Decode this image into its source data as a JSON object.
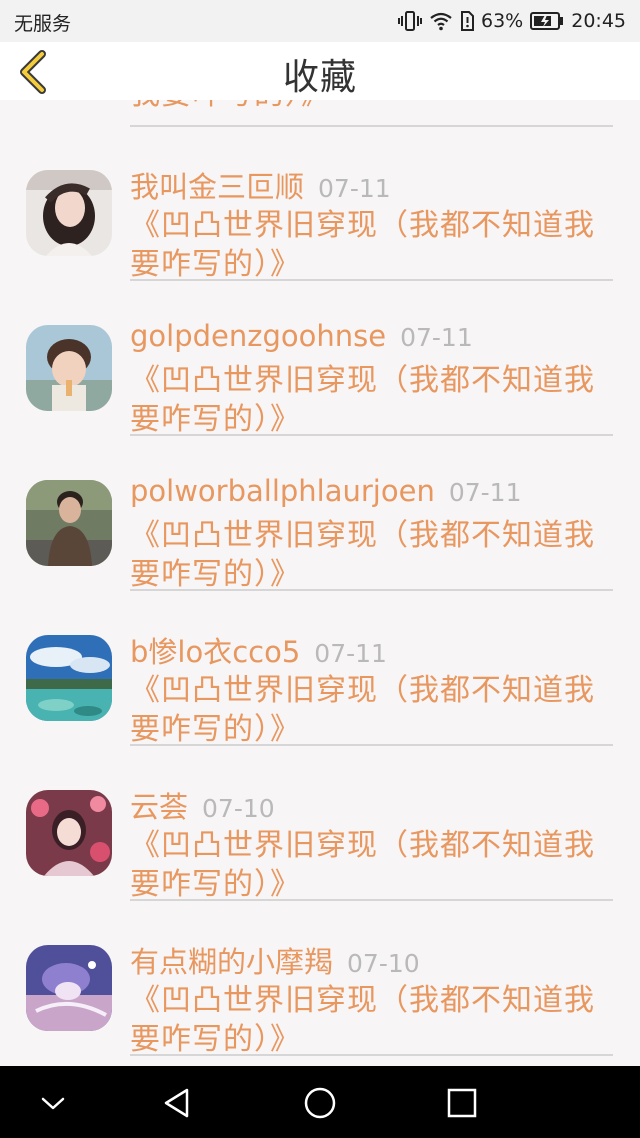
{
  "status_bar": {
    "carrier": "无服务",
    "battery_percent": "63%",
    "time": "20:45"
  },
  "header": {
    "title": "收藏",
    "back_icon": "chevron-left-icon",
    "accent": "#e8975f"
  },
  "partial_item": {
    "content": "我要咋写的）》"
  },
  "items": [
    {
      "name": "我叫金三叵顺",
      "date": "07-11",
      "content": "《凹凸世界旧穿现（我都不知道我要咋写的）》"
    },
    {
      "name": "golpdenzgoohnse",
      "date": "07-11",
      "content": "《凹凸世界旧穿现（我都不知道我要咋写的）》"
    },
    {
      "name": "polworballphlaurjoen",
      "date": "07-11",
      "content": "《凹凸世界旧穿现（我都不知道我要咋写的）》"
    },
    {
      "name": "b惨lo衣cco5",
      "date": "07-11",
      "content": "《凹凸世界旧穿现（我都不知道我要咋写的）》"
    },
    {
      "name": "云荟",
      "date": "07-10",
      "content": "《凹凸世界旧穿现（我都不知道我要咋写的）》"
    },
    {
      "name": "有点糊的小摩羯",
      "date": "07-10",
      "content": "《凹凸世界旧穿现（我都不知道我要咋写的）》"
    }
  ],
  "system_nav": [
    "back-triangle-icon",
    "home-circle-icon",
    "recents-square-icon",
    "collapse-chevron-icon"
  ]
}
